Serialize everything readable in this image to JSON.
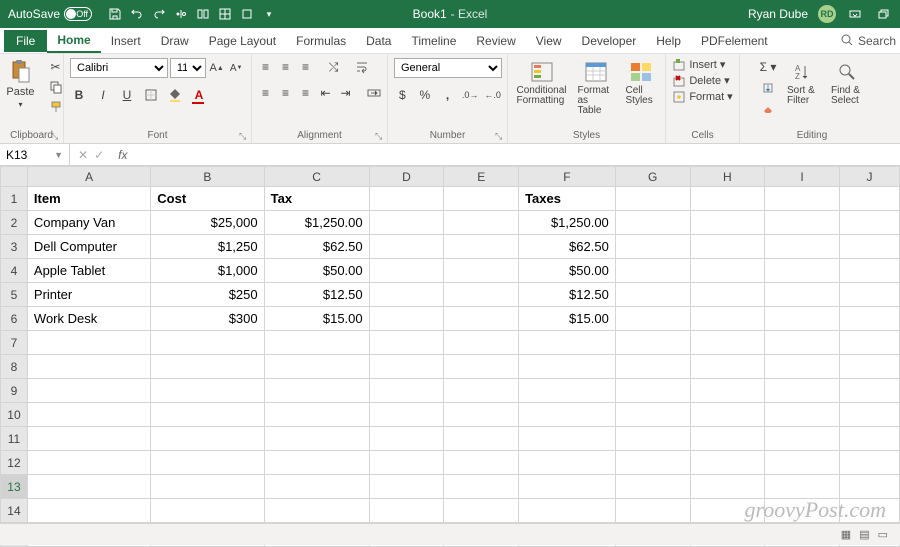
{
  "titlebar": {
    "autosave": "AutoSave",
    "toggle": "Off",
    "doc": "Book1",
    "app": "- Excel",
    "user": "Ryan Dube",
    "initials": "RD"
  },
  "tabs": {
    "file": "File",
    "home": "Home",
    "insert": "Insert",
    "draw": "Draw",
    "pagelayout": "Page Layout",
    "formulas": "Formulas",
    "data": "Data",
    "timeline": "Timeline",
    "review": "Review",
    "view": "View",
    "developer": "Developer",
    "help": "Help",
    "pdfelement": "PDFelement",
    "search": "Search"
  },
  "ribbon": {
    "clipboard": {
      "paste": "Paste",
      "label": "Clipboard"
    },
    "font": {
      "name": "Calibri",
      "size": "11",
      "label": "Font"
    },
    "alignment": {
      "label": "Alignment"
    },
    "number": {
      "format": "General",
      "label": "Number"
    },
    "styles": {
      "cond": "Conditional Formatting",
      "table": "Format as Table",
      "cell": "Cell Styles",
      "label": "Styles"
    },
    "cells": {
      "insert": "Insert",
      "delete": "Delete",
      "format": "Format",
      "label": "Cells"
    },
    "editing": {
      "sort": "Sort & Filter",
      "find": "Find & Select",
      "label": "Editing"
    }
  },
  "namebox": "K13",
  "columns": [
    "A",
    "B",
    "C",
    "D",
    "E",
    "F",
    "G",
    "H",
    "I",
    "J"
  ],
  "headers": {
    "A": "Item",
    "B": "Cost",
    "C": "Tax",
    "F": "Taxes"
  },
  "rows": [
    {
      "A": "Company Van",
      "B": "$25,000",
      "C": "$1,250.00",
      "F": "$1,250.00"
    },
    {
      "A": "Dell Computer",
      "B": "$1,250",
      "C": "$62.50",
      "F": "$62.50"
    },
    {
      "A": "Apple Tablet",
      "B": "$1,000",
      "C": "$50.00",
      "F": "$50.00"
    },
    {
      "A": "Printer",
      "B": "$250",
      "C": "$12.50",
      "F": "$12.50"
    },
    {
      "A": "Work Desk",
      "B": "$300",
      "C": "$15.00",
      "F": "$15.00"
    }
  ],
  "watermark": "groovyPost.com"
}
